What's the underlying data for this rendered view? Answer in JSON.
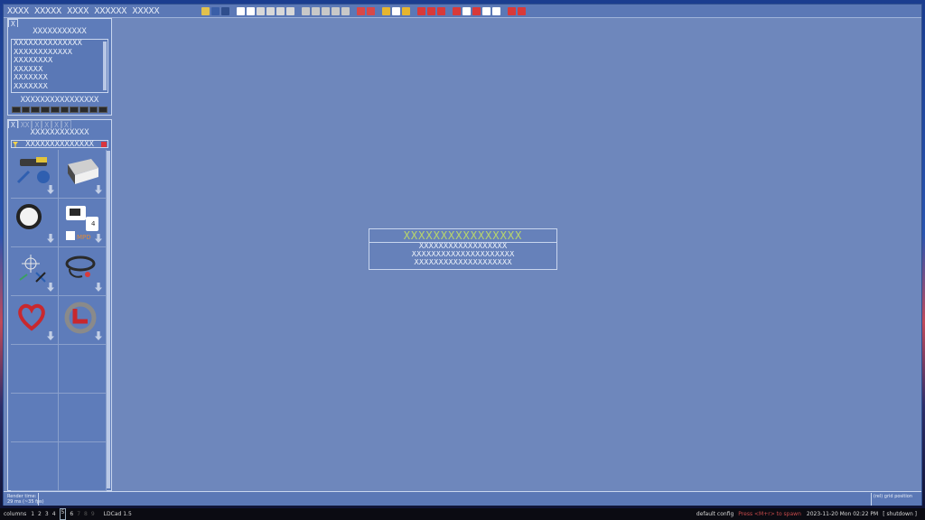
{
  "window": {
    "title": "XXXX XXXXX XXXX XXXXXX XXXXX"
  },
  "toolbar": {
    "groups": [
      [
        {
          "icon": "file-icon",
          "color": "#e2c14d"
        },
        {
          "icon": "monitor-icon",
          "color": "#3a5fa8"
        },
        {
          "icon": "screen-icon",
          "color": "#2f4e8d"
        }
      ],
      [
        {
          "icon": "undo-icon",
          "color": "#ffffff"
        },
        {
          "icon": "redo-icon",
          "color": "#ffffff"
        },
        {
          "icon": "copy-icon",
          "color": "#d8d8d8"
        },
        {
          "icon": "cut-icon",
          "color": "#d8d8d8"
        },
        {
          "icon": "paste-icon",
          "color": "#d8d8d8"
        },
        {
          "icon": "delete-icon",
          "color": "#d8d8d8"
        }
      ],
      [
        {
          "icon": "rotate-x-icon",
          "color": "#c8c8c8"
        },
        {
          "icon": "rotate-y-icon",
          "color": "#c8c8c8"
        },
        {
          "icon": "rotate-z-icon",
          "color": "#c8c8c8"
        },
        {
          "icon": "mirror-icon",
          "color": "#c8c8c8"
        },
        {
          "icon": "align-icon",
          "color": "#c8c8c8"
        }
      ],
      [
        {
          "icon": "group-icon",
          "color": "#d84848"
        },
        {
          "icon": "ungroup-icon",
          "color": "#d84848"
        }
      ],
      [
        {
          "icon": "color-icon",
          "color": "#e6b52f"
        },
        {
          "icon": "move-icon",
          "color": "#ffffff"
        },
        {
          "icon": "snap-icon",
          "color": "#e6b52f"
        }
      ],
      [
        {
          "icon": "grid-x-icon",
          "color": "#d83a3a"
        },
        {
          "icon": "grid-y-icon",
          "color": "#d83a3a"
        },
        {
          "icon": "grid-z-icon",
          "color": "#d83a3a"
        }
      ],
      [
        {
          "icon": "view-icon",
          "color": "#d83a3a"
        },
        {
          "icon": "pan-icon",
          "color": "#ffffff"
        },
        {
          "icon": "target-icon",
          "color": "#d83a3a"
        },
        {
          "icon": "zoom-icon",
          "color": "#ffffff"
        },
        {
          "icon": "fit-icon",
          "color": "#ffffff"
        }
      ],
      [
        {
          "icon": "favorite-icon",
          "color": "#d83a3a"
        },
        {
          "icon": "record-icon",
          "color": "#d83a3a"
        }
      ]
    ]
  },
  "panel1": {
    "tab_label": "X",
    "title": "XXXXXXXXXXX",
    "items": [
      "XXXXXXXXXXXXXX",
      "XXXXXXXXXXXX",
      "XXXXXXXX",
      "XXXXXX",
      "XXXXXXX",
      "XXXXXXX"
    ],
    "footer": "XXXXXXXXXXXXXXXX"
  },
  "panel2": {
    "tabs": [
      "X",
      "XX",
      "X",
      "X",
      "X",
      "X"
    ],
    "title": "XXXXXXXXXXXX",
    "filter_label": "XXXXXXXXXXXXXX",
    "cells": [
      {
        "icon": "technic-parts-icon",
        "colors": [
          "#3b3b3b",
          "#2f5fb0",
          "#e2c43a"
        ]
      },
      {
        "icon": "parts-box-icon",
        "colors": [
          "#cfcfcf",
          "#4a4a4a",
          "#f0f0f0"
        ]
      },
      {
        "icon": "magnifier-icon",
        "colors": [
          "#222222",
          "#f2f2f2",
          "#9a7a3a"
        ]
      },
      {
        "icon": "mpd-document-icon",
        "colors": [
          "#ffffff",
          "#2a2a2a",
          "#e08a3a"
        ]
      },
      {
        "icon": "axes-icon",
        "colors": [
          "#e8e8e8",
          "#3aa060",
          "#2a5fb0"
        ]
      },
      {
        "icon": "chain-icon",
        "colors": [
          "#2a2a2a",
          "#d8d8d8",
          "#d83a3a"
        ]
      },
      {
        "icon": "heart-icon",
        "colors": [
          "#c8282e",
          "#9a1a1e",
          "#c8282e"
        ]
      },
      {
        "icon": "turntable-icon",
        "colors": [
          "#8a8a8a",
          "#c8282e",
          "#6a6a6a"
        ]
      },
      {
        "icon": "empty-cell",
        "colors": []
      },
      {
        "icon": "empty-cell",
        "colors": []
      },
      {
        "icon": "empty-cell",
        "colors": []
      },
      {
        "icon": "empty-cell",
        "colors": []
      },
      {
        "icon": "empty-cell",
        "colors": []
      },
      {
        "icon": "empty-cell",
        "colors": []
      }
    ]
  },
  "dialog": {
    "title": "XXXXXXXXXXXXXXXX",
    "lines": [
      "XXXXXXXXXXXXXXXXXX",
      "XXXXXXXXXXXXXXXXXXXXX",
      "XXXXXXXXXXXXXXXXXXXX"
    ]
  },
  "status": {
    "render_label": "Render time:",
    "render_value": "29 ms (~35 fps)",
    "grid_position": "(rel) grid position"
  },
  "taskbar": {
    "columns": "columns",
    "workspaces": [
      "1",
      "2",
      "3",
      "4",
      "5",
      "6",
      "7",
      "8",
      "9"
    ],
    "active_workspace": "5",
    "app": "LDCad 1.5",
    "config": "default config",
    "hint": "Press <M+r> to spawn",
    "datetime": "2023-11-20 Mon 02:22 PM",
    "shutdown": "[ shutdown ]"
  }
}
